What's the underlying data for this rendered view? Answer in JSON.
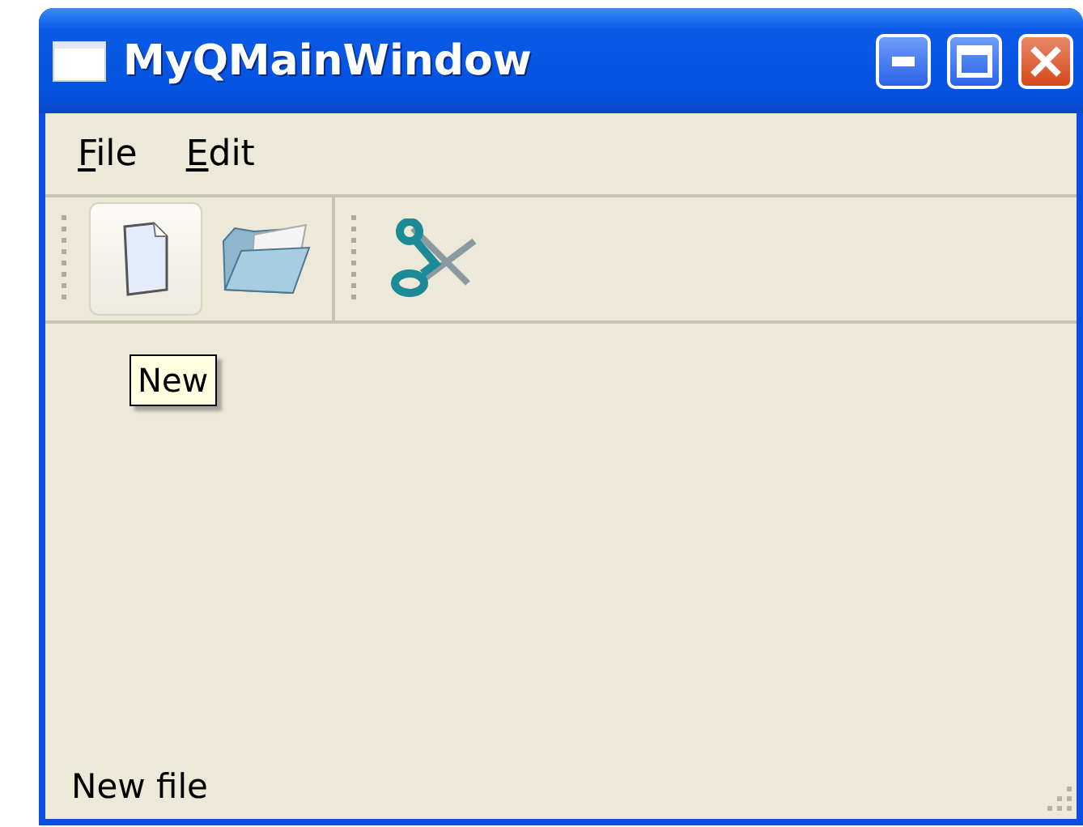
{
  "window": {
    "title": "MyQMainWindow",
    "controls": [
      {
        "kind": "minimize"
      },
      {
        "kind": "maximize"
      },
      {
        "kind": "close"
      }
    ]
  },
  "menu": [
    {
      "label": "File"
    },
    {
      "label": "Edit"
    }
  ],
  "toolbars": [
    {
      "buttons": [
        {
          "kind": "new",
          "hovered": true
        },
        {
          "kind": "open",
          "hovered": false
        }
      ]
    },
    {
      "buttons": [
        {
          "kind": "cut",
          "hovered": false
        }
      ]
    }
  ],
  "tooltip": {
    "text": "New"
  },
  "status_bar": {
    "text": "New file"
  }
}
